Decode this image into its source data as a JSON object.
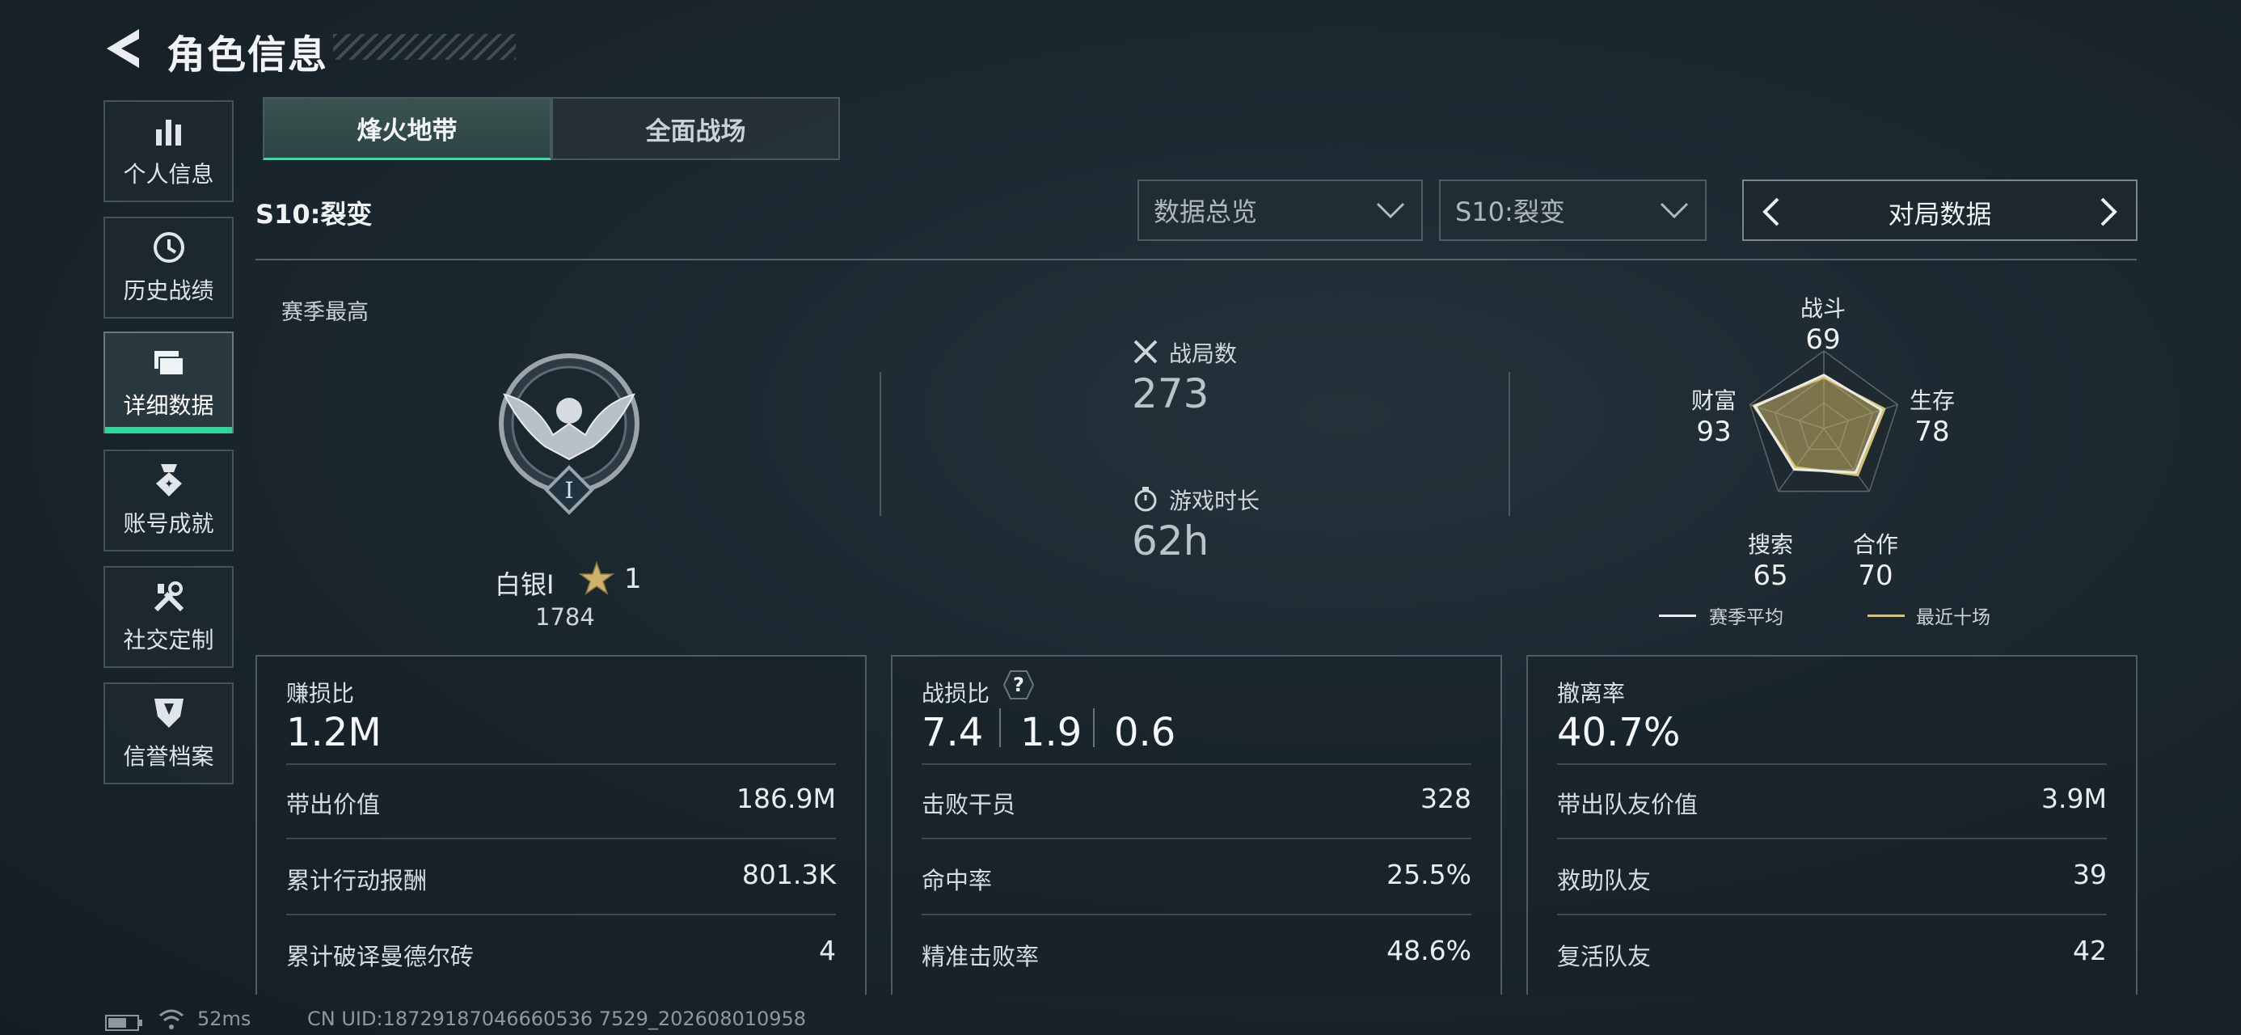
{
  "header": {
    "title": "角色信息"
  },
  "sidebar": {
    "items": [
      {
        "label": "个人信息",
        "icon": "bar-chart-icon"
      },
      {
        "label": "历史战绩",
        "icon": "history-icon"
      },
      {
        "label": "详细数据",
        "icon": "folder-icon",
        "active": true
      },
      {
        "label": "账号成就",
        "icon": "medal-icon"
      },
      {
        "label": "社交定制",
        "icon": "tools-icon"
      },
      {
        "label": "信誉档案",
        "icon": "shield-icon"
      }
    ]
  },
  "tabs": [
    {
      "label": "烽火地带",
      "active": true
    },
    {
      "label": "全面战场",
      "active": false
    }
  ],
  "season": {
    "label": "S10:裂变"
  },
  "filters": {
    "overview": "数据总览",
    "season_select": "S10:裂变",
    "nav_label": "对局数据"
  },
  "rank": {
    "section_title": "赛季最高",
    "name": "白银Ⅰ",
    "stars": "1",
    "score": "1784",
    "badge_numeral": "I"
  },
  "stats": {
    "matches_label": "战局数",
    "matches_value": "273",
    "playtime_label": "游戏时长",
    "playtime_value": "62h"
  },
  "radar": {
    "axes": [
      {
        "label": "战斗",
        "value": "69"
      },
      {
        "label": "生存",
        "value": "78"
      },
      {
        "label": "合作",
        "value": "70"
      },
      {
        "label": "搜索",
        "value": "65"
      },
      {
        "label": "财富",
        "value": "93"
      }
    ],
    "season_avg_fraction": [
      0.69,
      0.78,
      0.7,
      0.65,
      0.93
    ],
    "recent_fraction": [
      0.66,
      0.82,
      0.74,
      0.62,
      0.95
    ],
    "legend_season": "赛季平均",
    "legend_recent": "最近十场",
    "colors": {
      "season": "#e8ecef",
      "recent": "#d9c26a"
    }
  },
  "panels": {
    "profit": {
      "title": "赚损比",
      "main": "1.2M",
      "rows": [
        {
          "label": "带出价值",
          "value": "186.9M"
        },
        {
          "label": "累计行动报酬",
          "value": "801.3K"
        },
        {
          "label": "累计破译曼德尔砖",
          "value": "4"
        }
      ]
    },
    "combat": {
      "title": "战损比",
      "help": "?",
      "values": [
        "7.4",
        "1.9",
        "0.6"
      ],
      "rows": [
        {
          "label": "击败干员",
          "value": "328"
        },
        {
          "label": "命中率",
          "value": "25.5%"
        },
        {
          "label": "精准击败率",
          "value": "48.6%"
        }
      ]
    },
    "extract": {
      "title": "撤离率",
      "main": "40.7%",
      "rows": [
        {
          "label": "带出队友价值",
          "value": "3.9M"
        },
        {
          "label": "救助队友",
          "value": "39"
        },
        {
          "label": "复活队友",
          "value": "42"
        }
      ]
    }
  },
  "footer": {
    "ping": "52ms",
    "uid": "CN UID:18729187046660536 7529_202608010958"
  },
  "colors": {
    "accent": "#2fd89a",
    "gold": "#d9c26a"
  }
}
